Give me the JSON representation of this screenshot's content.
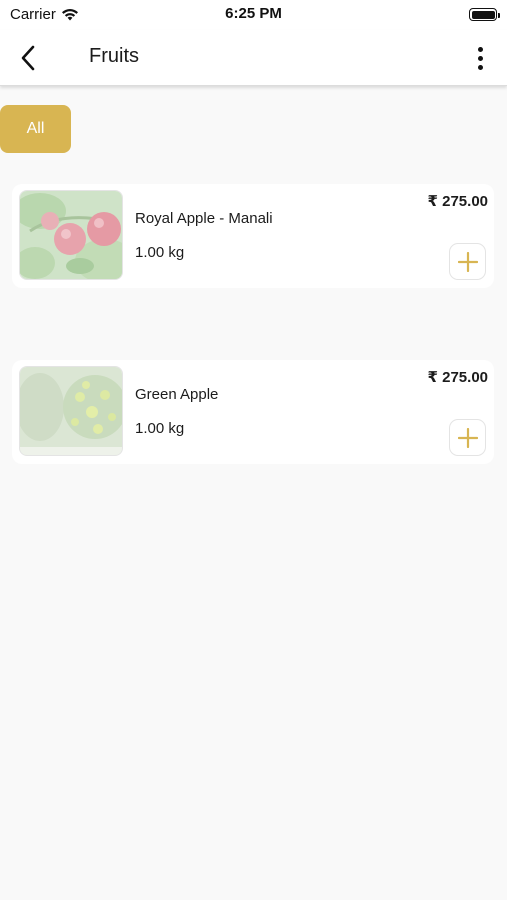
{
  "status_bar": {
    "carrier": "Carrier",
    "time": "6:25 PM"
  },
  "nav": {
    "title": "Fruits",
    "back_icon": "chevron-left-icon",
    "more_icon": "more-vertical-icon"
  },
  "filters": {
    "chips": [
      {
        "label": "All",
        "selected": true
      }
    ]
  },
  "products": [
    {
      "name": "Royal Apple - Manali",
      "quantity": "1.00 kg",
      "price": "₹ 275.00",
      "image_icon": "red-apple-photo"
    },
    {
      "name": "Green Apple",
      "quantity": "1.00 kg",
      "price": "₹ 275.00",
      "image_icon": "green-apple-photo"
    }
  ],
  "colors": {
    "accent": "#d8b552",
    "background": "#f9f9f9",
    "card": "#ffffff",
    "text": "#1c1c1c"
  }
}
